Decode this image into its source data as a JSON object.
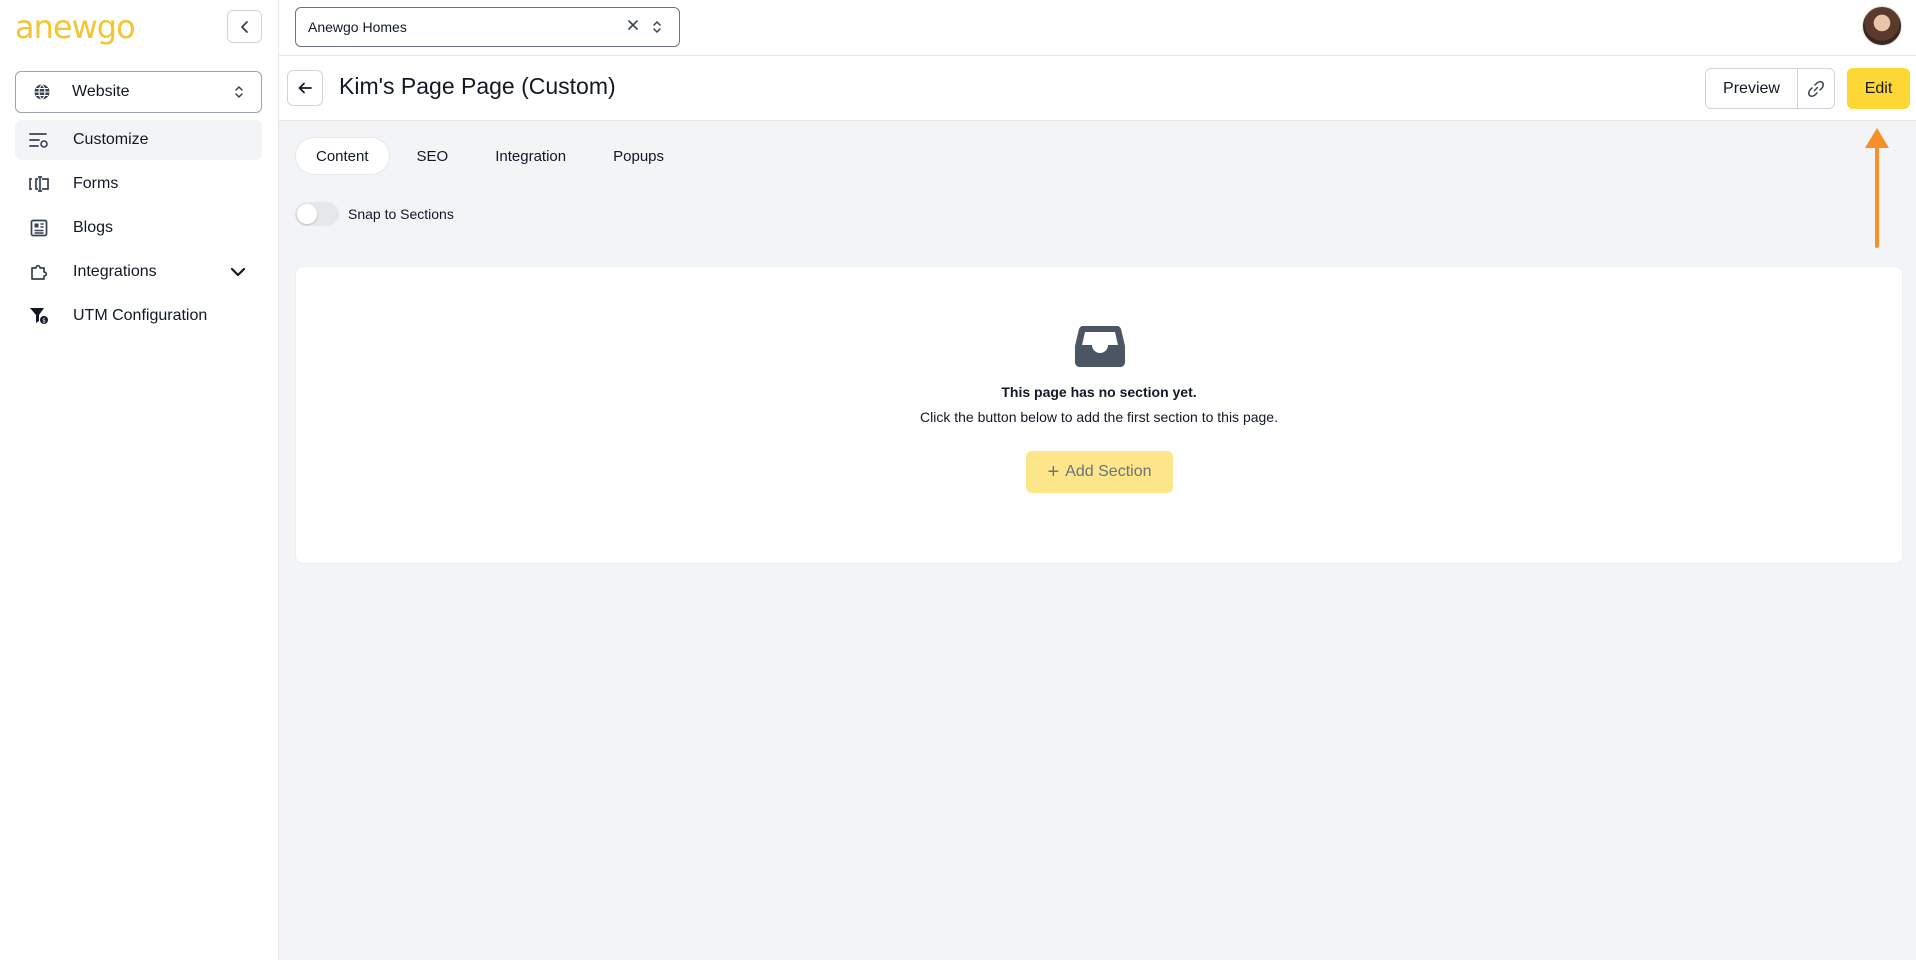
{
  "brand": {
    "logo_text": "anewgo",
    "accent": "#fdd835"
  },
  "sidebar": {
    "site_select": {
      "icon": "globe-icon",
      "label": "Website"
    },
    "items": [
      {
        "label": "Customize",
        "icon": "customize-icon",
        "active": true
      },
      {
        "label": "Forms",
        "icon": "forms-icon"
      },
      {
        "label": "Blogs",
        "icon": "blogs-icon"
      },
      {
        "label": "Integrations",
        "icon": "puzzle-icon",
        "expandable": true
      },
      {
        "label": "UTM Configuration",
        "icon": "funnel-icon"
      }
    ]
  },
  "topbar": {
    "company_value": "Anewgo Homes",
    "avatar": "user-avatar"
  },
  "header": {
    "title": "Kim's Page Page (Custom)",
    "preview_label": "Preview",
    "edit_label": "Edit"
  },
  "tabs": [
    {
      "label": "Content",
      "active": true
    },
    {
      "label": "SEO"
    },
    {
      "label": "Integration"
    },
    {
      "label": "Popups"
    }
  ],
  "toggle": {
    "label": "Snap to Sections",
    "on": false
  },
  "empty_state": {
    "icon": "inbox-icon",
    "title": "This page has no section yet.",
    "subtitle": "Click the button below to add the first section to this page.",
    "button_label": "Add Section"
  },
  "annotation": {
    "arrow_color": "#f7902a"
  }
}
